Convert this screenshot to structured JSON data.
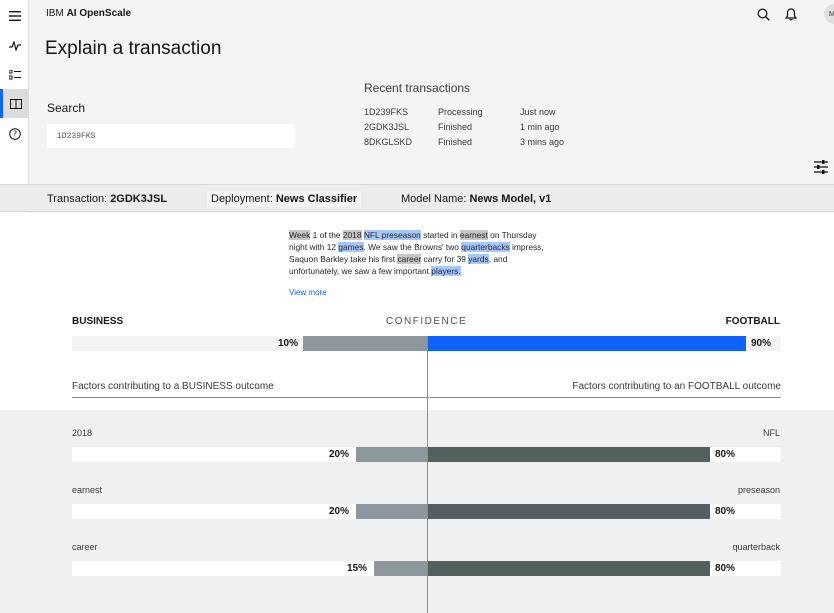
{
  "app": {
    "brand_prefix": "IBM",
    "brand_name": "AI OpenScale",
    "user_initials": "MF"
  },
  "page": {
    "title": "Explain a transaction"
  },
  "search": {
    "label": "Search",
    "value": "1D239FKS"
  },
  "recent": {
    "title": "Recent transactions",
    "rows": [
      {
        "id": "1D239FKS",
        "status": "Processing",
        "time": "Just now"
      },
      {
        "id": "2GDK3JSL",
        "status": "Finished",
        "time": "1 min ago"
      },
      {
        "id": "8DKGLSKD",
        "status": "Finished",
        "time": "3 mins ago"
      }
    ]
  },
  "info": {
    "transaction_label": "Transaction:",
    "transaction_value": "2GDK3JSL",
    "deployment_label": "Deployment:",
    "deployment_value": "News Classifier",
    "model_label": "Model Name:",
    "model_value": "News Model, v1"
  },
  "text": {
    "segments": [
      {
        "t": "Week",
        "h": "grey"
      },
      {
        "t": " 1 of the ",
        "h": ""
      },
      {
        "t": "2018",
        "h": "grey"
      },
      {
        "t": " ",
        "h": ""
      },
      {
        "t": "NFL preseason",
        "h": "blue"
      },
      {
        "t": " started in ",
        "h": ""
      },
      {
        "t": "earnest",
        "h": "grey"
      },
      {
        "t": " on Thursday night with 12 ",
        "h": ""
      },
      {
        "t": "games",
        "h": "blue"
      },
      {
        "t": ". We saw the Browns' two ",
        "h": ""
      },
      {
        "t": "quarterbacks",
        "h": "blue"
      },
      {
        "t": " impress, Saquon Barkley take his first ",
        "h": ""
      },
      {
        "t": "career",
        "h": "grey"
      },
      {
        "t": " carry for 39 ",
        "h": ""
      },
      {
        "t": "yards",
        "h": "blue"
      },
      {
        "t": ", and unfortunately, we saw a few important ",
        "h": ""
      },
      {
        "t": "players.",
        "h": "blue"
      }
    ],
    "view_more": "View more"
  },
  "confidence": {
    "left_label": "BUSINESS",
    "right_label": "FOOTBALL",
    "center_label": "CONFIDENCE",
    "left_value": 0.1,
    "right_value": 0.9,
    "left_text": "10%",
    "right_text": "90%"
  },
  "factors": {
    "left_header": "Factors contributing to a BUSINESS outcome",
    "right_header": "Factors contributing to an FOOTBALL outcome",
    "rows": [
      {
        "left_label": "2018",
        "left_value": 0.2,
        "left_text": "20%",
        "right_label": "NFL",
        "right_value": 0.8,
        "right_text": "80%"
      },
      {
        "left_label": "earnest",
        "left_value": 0.2,
        "left_text": "20%",
        "right_label": "preseason",
        "right_value": 0.8,
        "right_text": "80%"
      },
      {
        "left_label": "career",
        "left_value": 0.15,
        "left_text": "15%",
        "right_label": "quarterback",
        "right_value": 0.8,
        "right_text": "80%"
      }
    ]
  },
  "colors": {
    "primary": "#0f62fe",
    "business_bar": "#8d989e",
    "football_bar": "#545f61",
    "conf_left": "#8d989e"
  },
  "icons": {
    "menu": "menu-icon",
    "activity": "activity-icon",
    "list": "list-icon",
    "explain": "explain-icon",
    "help": "help-icon",
    "search": "search-icon",
    "notification": "notification-icon",
    "filter": "filter-settings-icon"
  }
}
